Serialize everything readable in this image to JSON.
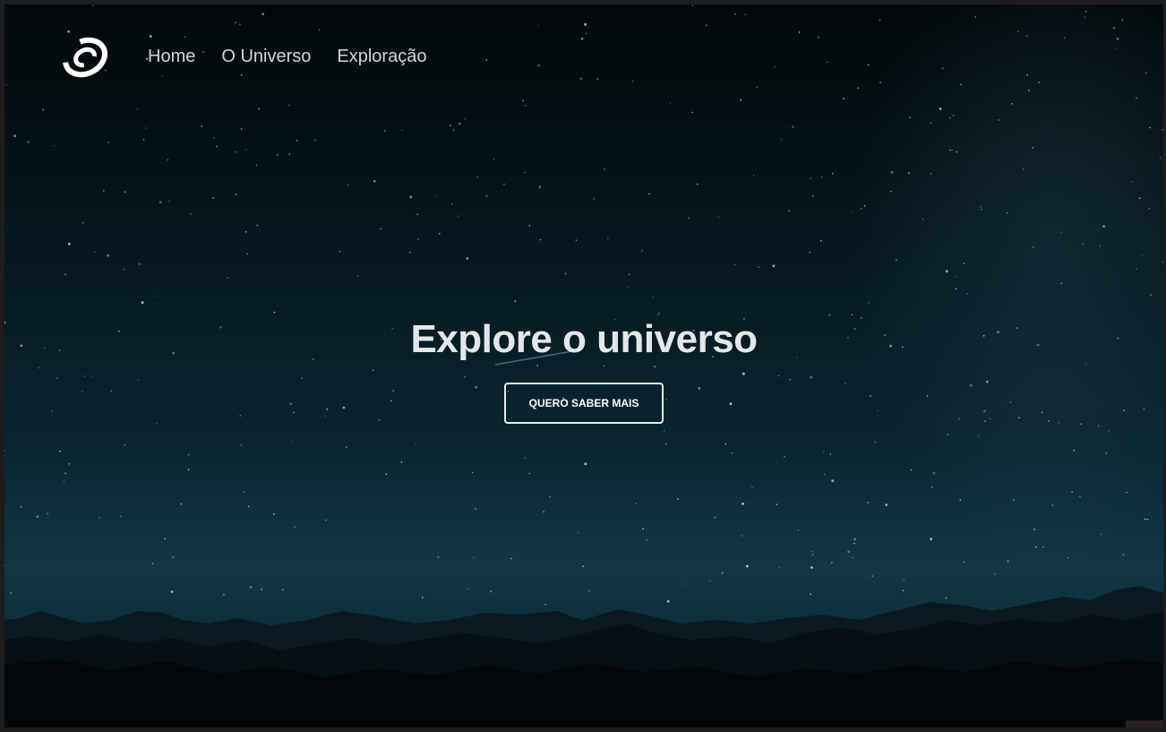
{
  "nav": {
    "logo_icon": "spiral-galaxy-icon",
    "links": [
      {
        "label": "Home"
      },
      {
        "label": "O Universo"
      },
      {
        "label": "Exploração"
      }
    ]
  },
  "hero": {
    "title": "Explore o universo",
    "button_label": "QUERO SABER MAIS"
  },
  "colors": {
    "sky_top": "#03080b",
    "sky_horizon": "#113745",
    "text": "#e4e7e9",
    "nav_text": "#d0d6da"
  }
}
